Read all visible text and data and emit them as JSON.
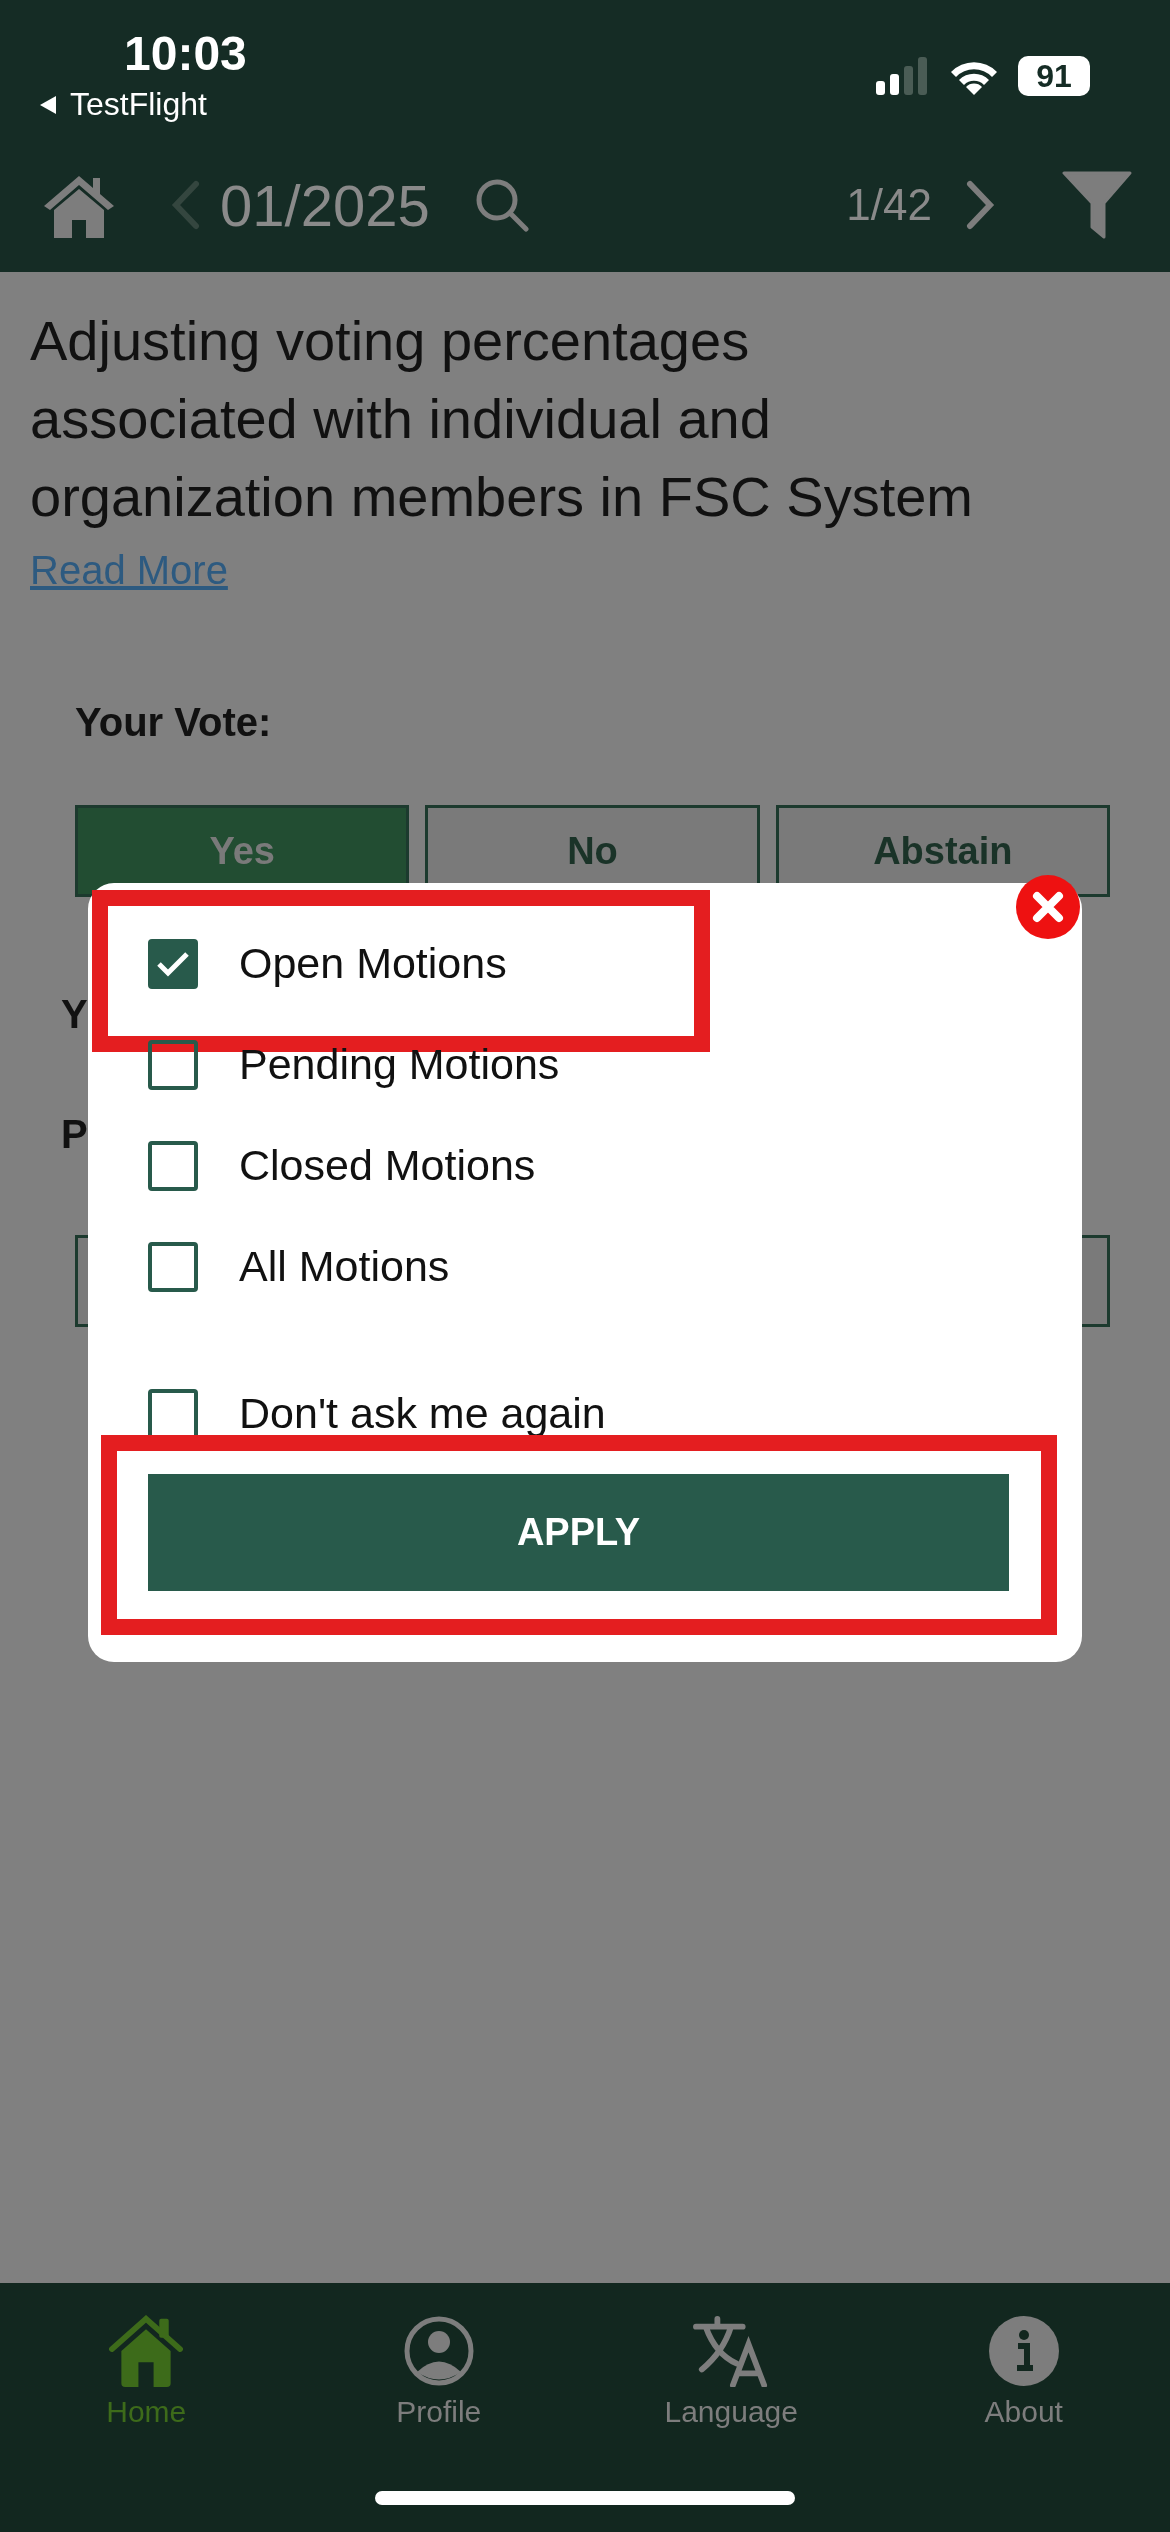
{
  "status_bar": {
    "time": "10:03",
    "back_label": "TestFlight",
    "battery": "91"
  },
  "nav": {
    "period": "01/2025",
    "position": "1/42"
  },
  "motion": {
    "title": "Adjusting voting percentages associated with individual and organization members in FSC System",
    "link": "Read More",
    "vote_label": "Your Vote:",
    "vote_options": [
      {
        "label": "Yes",
        "selected": true
      },
      {
        "label": "No",
        "selected": false
      },
      {
        "label": "Abstain",
        "selected": false
      }
    ],
    "covered_labels": [
      "Y",
      "P"
    ]
  },
  "filter_dialog": {
    "options": [
      {
        "label": "Open Motions",
        "checked": true,
        "highlighted": true
      },
      {
        "label": "Pending Motions",
        "checked": false,
        "highlighted": false
      },
      {
        "label": "Closed Motions",
        "checked": false,
        "highlighted": false
      },
      {
        "label": "All Motions",
        "checked": false,
        "highlighted": false
      }
    ],
    "dont_ask": {
      "label": "Don't ask me again",
      "checked": false
    },
    "apply": {
      "label": "APPLY",
      "highlighted": true
    }
  },
  "tab_bar": [
    {
      "label": "Home",
      "selected": true
    },
    {
      "label": "Profile",
      "selected": false
    },
    {
      "label": "Language",
      "selected": false
    },
    {
      "label": "About",
      "selected": false
    }
  ]
}
